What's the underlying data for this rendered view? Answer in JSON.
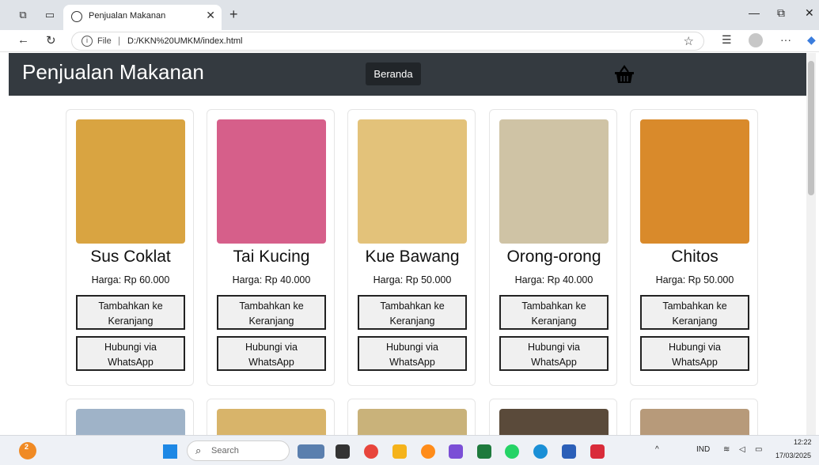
{
  "browser": {
    "tab_title": "Penjualan Makanan",
    "tab_close": "✕",
    "new_tab": "+",
    "url_label": "File",
    "url_separator": "|",
    "url": "D:/KKN%20UMKM/index.html",
    "window_min": "—",
    "window_restore": "⧉",
    "window_close": "✕"
  },
  "navbar": {
    "brand": "Penjualan Makanan",
    "home_button": "Beranda"
  },
  "products": [
    {
      "name": "Sus Coklat",
      "price": "Harga: Rp 60.000",
      "add_label": "Tambahkan ke Keranjang",
      "wa_label": "Hubungi via WhatsApp",
      "color": "#d9a441"
    },
    {
      "name": "Tai Kucing",
      "price": "Harga: Rp 40.000",
      "add_label": "Tambahkan ke Keranjang",
      "wa_label": "Hubungi via WhatsApp",
      "color": "#d65f8a"
    },
    {
      "name": "Kue Bawang",
      "price": "Harga: Rp 50.000",
      "add_label": "Tambahkan ke Keranjang",
      "wa_label": "Hubungi via WhatsApp",
      "color": "#e3c27a"
    },
    {
      "name": "Orong-orong",
      "price": "Harga: Rp 40.000",
      "add_label": "Tambahkan ke Keranjang",
      "wa_label": "Hubungi via WhatsApp",
      "color": "#cfc3a5"
    },
    {
      "name": "Chitos",
      "price": "Harga: Rp 50.000",
      "add_label": "Tambahkan ke Keranjang",
      "wa_label": "Hubungi via WhatsApp",
      "color": "#d98a2b"
    }
  ],
  "taskbar": {
    "search_placeholder": "Search",
    "weather_badge": "2",
    "tray_lang": "IND",
    "time": "12:22",
    "date": "17/03/2025"
  }
}
